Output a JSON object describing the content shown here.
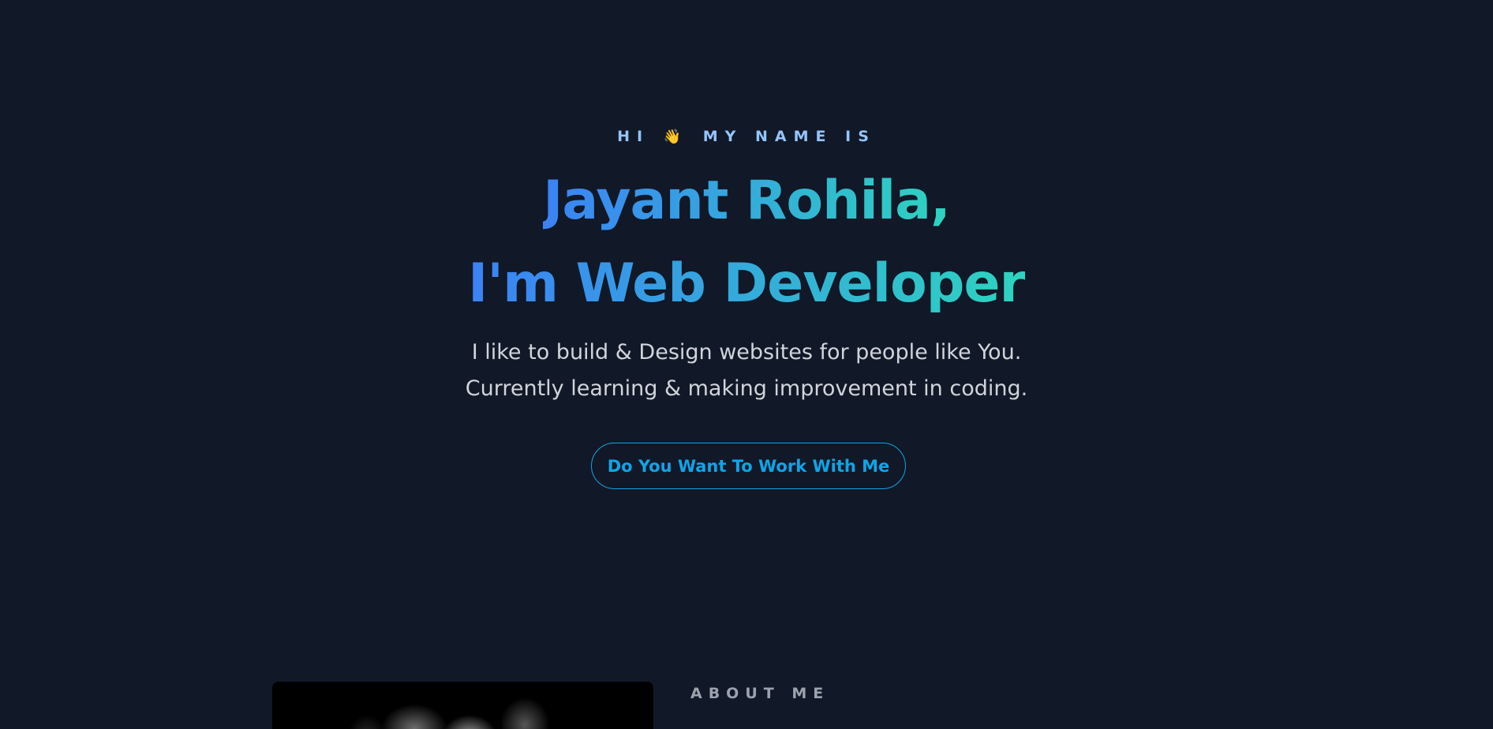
{
  "hero": {
    "greeting_pre": "HI",
    "greeting_post": "MY NAME IS",
    "wave_icon": "👋",
    "name_line": "Jayant Rohila,",
    "role_line": "I'm Web Developer",
    "intro_line1": "I like to build & Design websites for people like You.",
    "intro_line2": "Currently learning & making improvement in coding.",
    "cta_label": "Do You Want To Work With Me"
  },
  "about": {
    "label": "ABOUT ME"
  },
  "colors": {
    "background": "#111827",
    "gradient_start": "#3b82f6",
    "gradient_end": "#2dd4bf",
    "accent": "#0ea5e9",
    "greeting": "#93c5fd"
  }
}
